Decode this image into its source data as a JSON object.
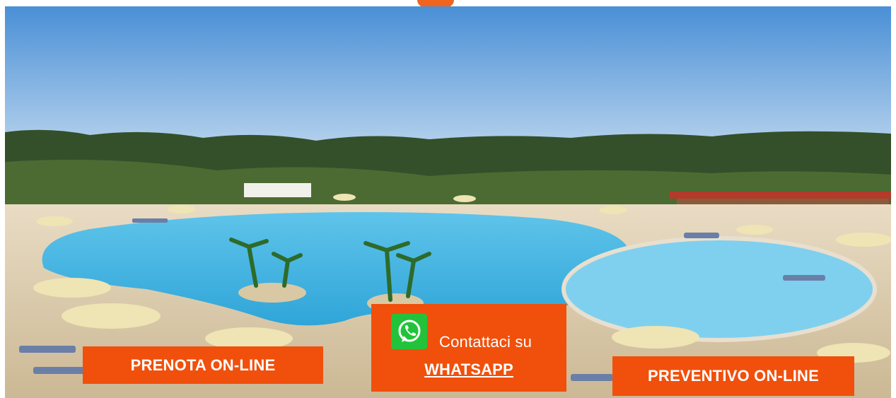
{
  "hero": {
    "image_alt": "resort swimming pool",
    "colors": {
      "sky": "#9cc8ee",
      "pool": "#6ec6e8",
      "trees": "#3d5a2a",
      "cta": "#f0500c",
      "whatsapp": "#22c33a"
    }
  },
  "cta": {
    "prenota_label": "PRENOTA ON-LINE",
    "whatsapp_text": "Contattaci su",
    "whatsapp_label": "WHATSAPP",
    "whatsapp_icon": "whatsapp-icon",
    "preventivo_label": "PREVENTIVO ON-LINE"
  }
}
